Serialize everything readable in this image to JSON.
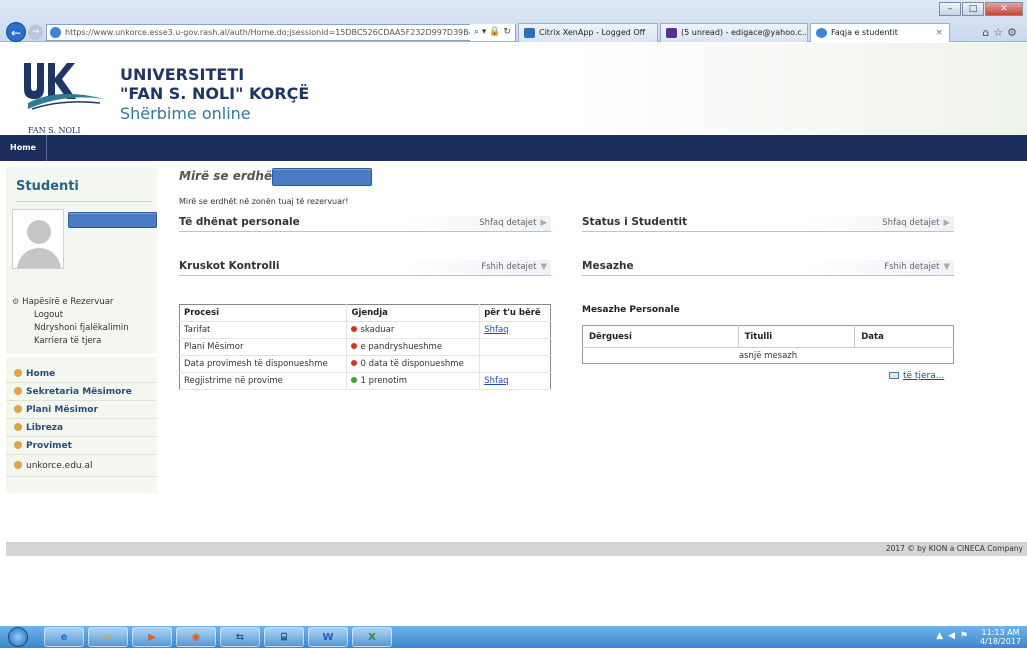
{
  "browser": {
    "url": "https://www.unkorce.esse3.u-gov.rash.al/auth/Home.do;jsessionid=15DBC526CDAA5F232D997D39B4D(",
    "tabs": [
      {
        "label": "Citrix XenApp - Logged Off"
      },
      {
        "label": "(5 unread) - edigace@yahoo.c..."
      },
      {
        "label": "Faqja e studentit"
      }
    ],
    "tab_close": "×"
  },
  "header": {
    "uni_line1": "UNIVERSITETI",
    "uni_line2": "\"FAN S. NOLI\" KORÇË",
    "subtitle": "Shërbime online",
    "logo_caption": "FAN S. NOLI"
  },
  "navbar": {
    "home": "Home"
  },
  "sidebar": {
    "title": "Studenti",
    "reserved_area": "Hapësirë e Rezervuar",
    "links": [
      "Logout",
      "Ndryshoni fjalëkalimin",
      "Karriera të tjera"
    ],
    "menu": [
      "Home",
      "Sekretaria Mësimore",
      "Plani Mësimor",
      "Libreza",
      "Provimet"
    ],
    "external_link": "unkorce.edu.al"
  },
  "main": {
    "welcome": "Mirë se erdhët",
    "welcome_sub": "Mirë se erdhët në zonën tuaj të rezervuar!",
    "panels": {
      "personal": {
        "title": "Të dhënat personale",
        "action": "Shfaq detajet"
      },
      "status": {
        "title": "Status i Studentit",
        "action": "Shfaq detajet"
      },
      "kontrolli": {
        "title": "Kruskot Kontrolli",
        "action": "Fshih detajet"
      },
      "mesazhe": {
        "title": "Mesazhe",
        "action": "Fshih detajet"
      }
    },
    "process_table": {
      "headers": [
        "Procesi",
        "Gjendja",
        "për t'u bërë"
      ],
      "rows": [
        {
          "process": "Tarifat",
          "state": "skaduar",
          "state_color": "#d9321f",
          "action": "Shfaq"
        },
        {
          "process": "Plani Mësimor",
          "state": "e pandryshueshme",
          "state_color": "#d9321f",
          "action": ""
        },
        {
          "process": "Data provimesh të disponueshme",
          "state": "0 data të disponueshme",
          "state_color": "#d9321f",
          "action": ""
        },
        {
          "process": "Regjistrime në provime",
          "state": "1 prenotim",
          "state_color": "#3aa332",
          "action": "Shfaq"
        }
      ]
    },
    "messages": {
      "title": "Mesazhe Personale",
      "headers": [
        "Dërguesi",
        "Titulli",
        "Data"
      ],
      "empty": "asnjë mesazh",
      "more": "të tjera..."
    }
  },
  "footer": {
    "text": "2017 © by KION a CINECA Company"
  },
  "taskbar": {
    "time": "11:13 AM",
    "date": "4/18/2017"
  },
  "colors": {
    "navbar": "#1c2f5c",
    "title_blue": "#1f3563",
    "subtitle_teal": "#2d7a9b",
    "menu_dot": "#e3a24a"
  }
}
